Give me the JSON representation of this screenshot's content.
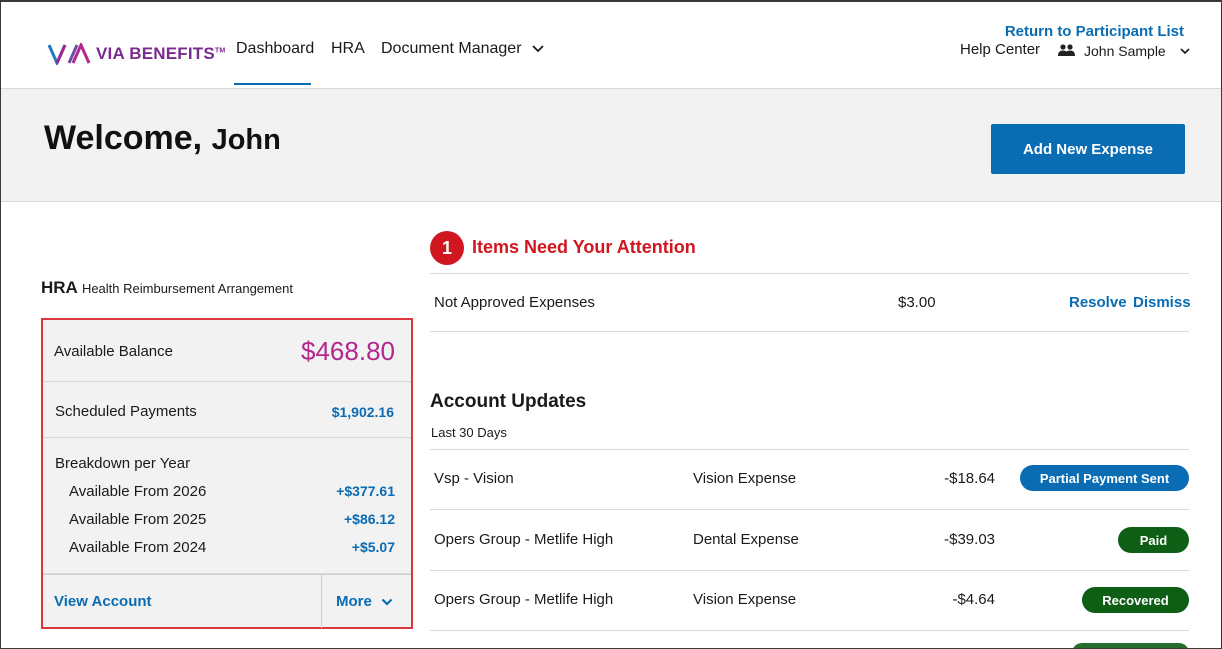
{
  "header": {
    "logo_text": "VIA BENEFITS",
    "logo_mark": "TM",
    "nav": {
      "dashboard": "Dashboard",
      "hra": "HRA",
      "document_manager": "Document Manager"
    },
    "return_link": "Return to Participant List",
    "help_center": "Help Center",
    "user_name": "John Sample",
    "colors": {
      "accent": "#0a6cb3",
      "brand": "#7a2b8f"
    }
  },
  "banner": {
    "welcome": "Welcome,",
    "name": "John",
    "add_expense_button": "Add New Expense"
  },
  "hra": {
    "title": "HRA",
    "subtitle": "Health Reimbursement Arrangement",
    "available_balance_label": "Available Balance",
    "available_balance_value": "$468.80",
    "scheduled_payments_label": "Scheduled Payments",
    "scheduled_payments_value": "$1,902.16",
    "breakdown_title": "Breakdown per Year",
    "breakdown": [
      {
        "label": "Available From 2026",
        "amount": "+$377.61"
      },
      {
        "label": "Available From 2025",
        "amount": "+$86.12"
      },
      {
        "label": "Available From 2024",
        "amount": "+$5.07"
      }
    ],
    "view_account": "View Account",
    "more": "More"
  },
  "attention": {
    "count": "1",
    "title": "Items Need Your Attention",
    "items": [
      {
        "label": "Not Approved Expenses",
        "amount": "$3.00",
        "resolve": "Resolve",
        "dismiss": "Dismiss"
      }
    ]
  },
  "updates": {
    "title": "Account Updates",
    "subtitle": "Last 30 Days",
    "rows": [
      {
        "name": "Vsp - Vision",
        "type": "Vision Expense",
        "amount": "-$18.64",
        "status": "Partial Payment Sent",
        "status_color": "#0a6cb3"
      },
      {
        "name": "Opers Group - Metlife High",
        "type": "Dental Expense",
        "amount": "-$39.03",
        "status": "Paid",
        "status_color": "#0e5e16"
      },
      {
        "name": "Opers Group - Metlife High",
        "type": "Vision Expense",
        "amount": "-$4.64",
        "status": "Recovered",
        "status_color": "#0e5e16"
      }
    ]
  }
}
